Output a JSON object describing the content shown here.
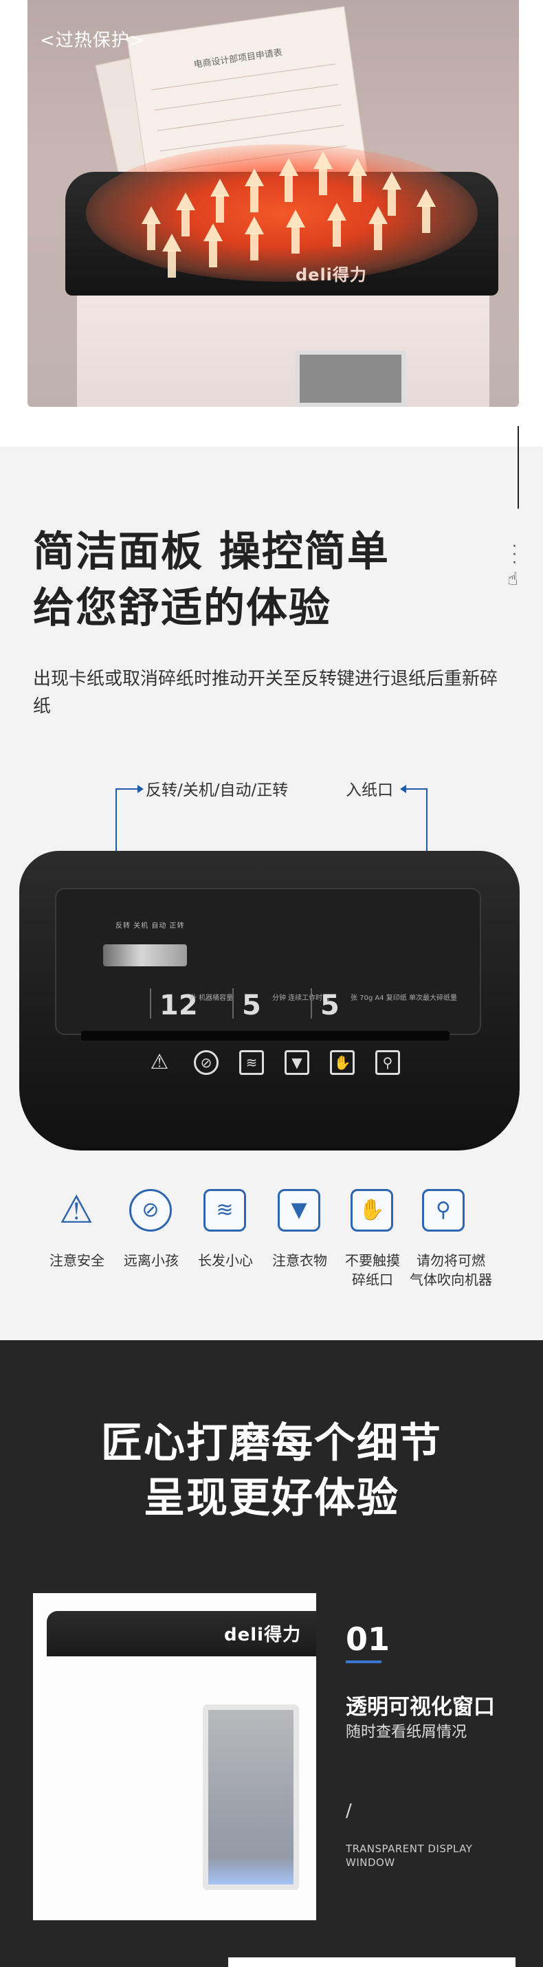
{
  "section1": {
    "badge": "<过热保护>",
    "paper_title": "电商设计部项目申请表"
  },
  "section2": {
    "heading_line1": "简洁面板 操控简单",
    "heading_line2": "给您舒适的体验",
    "description": "出现卡纸或取消碎纸时推动开关至反转键进行退纸后重新碎纸",
    "callout_left": "反转/关机/自动/正转",
    "callout_right": "入纸口",
    "switch_labels": "反转 关机 自动 正转",
    "specs": [
      {
        "num": "12",
        "sub": "升\n机器桶容量"
      },
      {
        "num": "5",
        "sub": "分钟\n连续工作时间"
      },
      {
        "num": "5",
        "sub": "张 70g A4 复印纸\n单次最大碎纸量"
      }
    ],
    "safety_icons": [
      {
        "icon": "warning-icon",
        "label": "注意安全"
      },
      {
        "icon": "no-children-icon",
        "label": "远离小孩"
      },
      {
        "icon": "long-hair-icon",
        "label": "长发小心"
      },
      {
        "icon": "tie-icon",
        "label": "注意衣物"
      },
      {
        "icon": "no-touch-icon",
        "label": "不要触摸\n碎纸口"
      },
      {
        "icon": "no-spray-icon",
        "label": "请勿将可燃\n气体吹向机器"
      }
    ],
    "accent_color": "#2d66b0"
  },
  "section3": {
    "heading_line1": "匠心打磨每个细节",
    "heading_line2": "呈现更好体验",
    "logo": "deli得力",
    "feature_num": "01",
    "feature_title": "透明可视化窗口",
    "feature_sub": "随时查看纸屑情况",
    "slash": "/",
    "feature_en": "TRANSPARENT DISPLAY\nWINDOW"
  }
}
